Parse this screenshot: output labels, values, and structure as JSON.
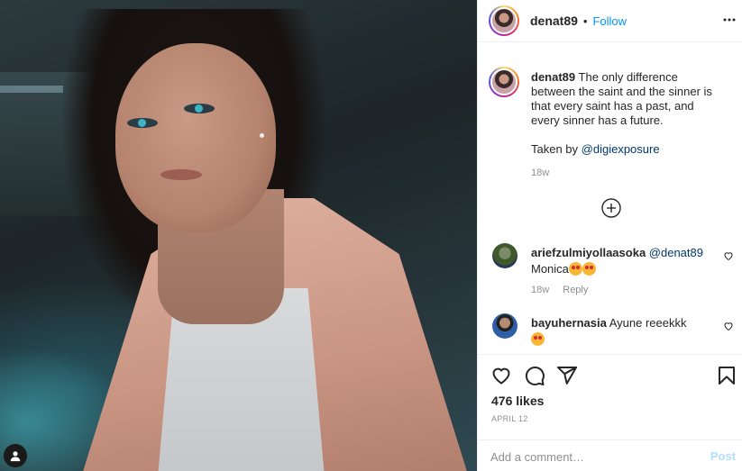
{
  "post": {
    "username": "denat89",
    "follow_label": "Follow",
    "separator": "•"
  },
  "caption": {
    "username": "denat89",
    "text": "The only difference between the saint and the sinner is that every saint has a past, and every sinner has a future.",
    "credit_prefix": "Taken by ",
    "credit_mention": "@digiexposure",
    "time": "18w"
  },
  "comments": [
    {
      "username": "ariefzulmiyollaasoka",
      "mention": "@denat89",
      "text": "Monica",
      "time": "18w",
      "reply_label": "Reply"
    },
    {
      "username": "bayuhernasia",
      "text": "Ayune reeekkk"
    }
  ],
  "footer": {
    "likes": "476 likes",
    "date": "APRIL 12",
    "comment_placeholder": "Add a comment…",
    "post_label": "Post"
  },
  "icons": {
    "more": "more-options-icon",
    "load_more": "plus-circle-icon",
    "like": "heart-icon",
    "comment": "comment-icon",
    "share": "share-icon",
    "save": "bookmark-icon",
    "tagged_user": "user-tag-icon"
  },
  "colors": {
    "link": "#0095f6",
    "mention": "#00376b",
    "muted": "#8e8e8e",
    "post_disabled": "#b2dffc"
  }
}
